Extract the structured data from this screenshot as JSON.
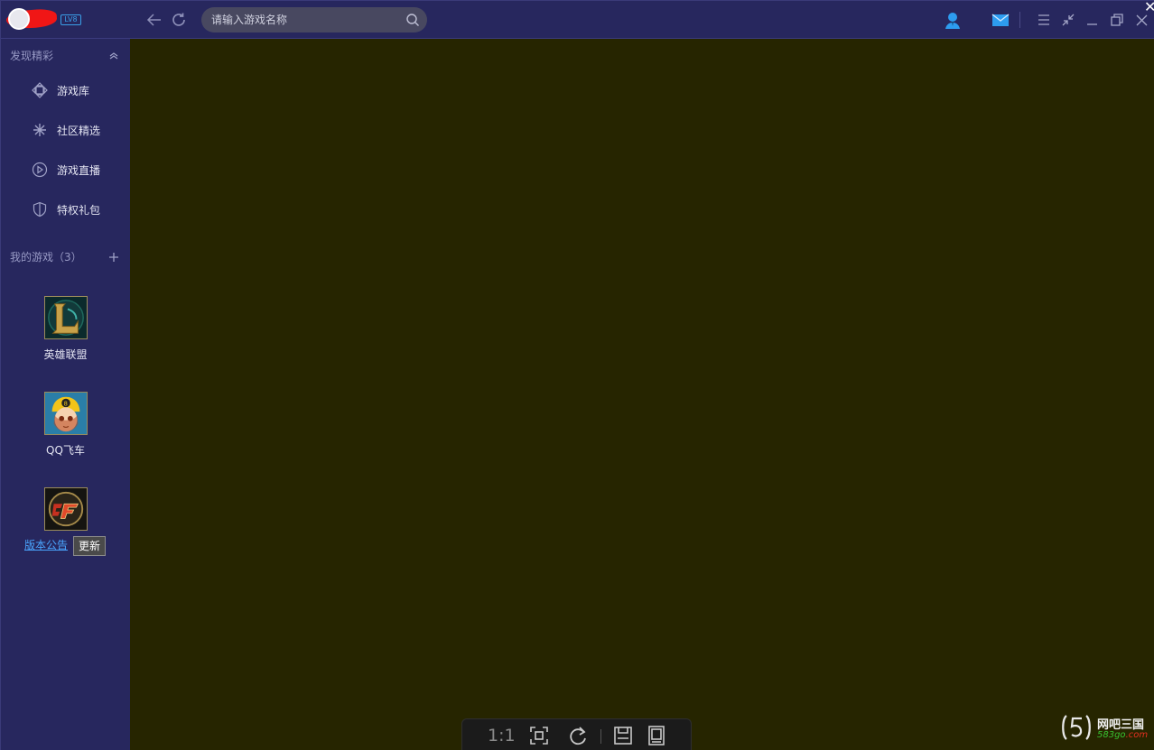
{
  "header": {
    "user_level_badge": "LV8",
    "search_placeholder": "请输入游戏名称"
  },
  "sidebar": {
    "discover_heading": "发现精彩",
    "menu_items": [
      {
        "label": "游戏库",
        "icon": "diamond-arrows-icon"
      },
      {
        "label": "社区精选",
        "icon": "asterisk-icon"
      },
      {
        "label": "游戏直播",
        "icon": "play-circle-icon"
      },
      {
        "label": "特权礼包",
        "icon": "shield-icon"
      }
    ],
    "my_games_heading": "我的游戏（3）",
    "games": [
      {
        "label": "英雄联盟",
        "icon": "league-of-legends-icon"
      },
      {
        "label": "QQ飞车",
        "icon": "qq-speed-icon"
      },
      {
        "label": "",
        "icon": "crossfire-icon"
      }
    ],
    "notice_link": "版本公告",
    "update_button": "更新"
  },
  "viewer_toolbar": {
    "actual_size_label": "1:1"
  },
  "watermark": {
    "brand_cn": "网吧三国",
    "domain_part1": "583go",
    "domain_part2": ".com"
  },
  "colors": {
    "sidebar_bg": "#27275e",
    "content_bg": "#262500",
    "link": "#4aa6ff",
    "accent_blue": "#2d9cf0"
  }
}
